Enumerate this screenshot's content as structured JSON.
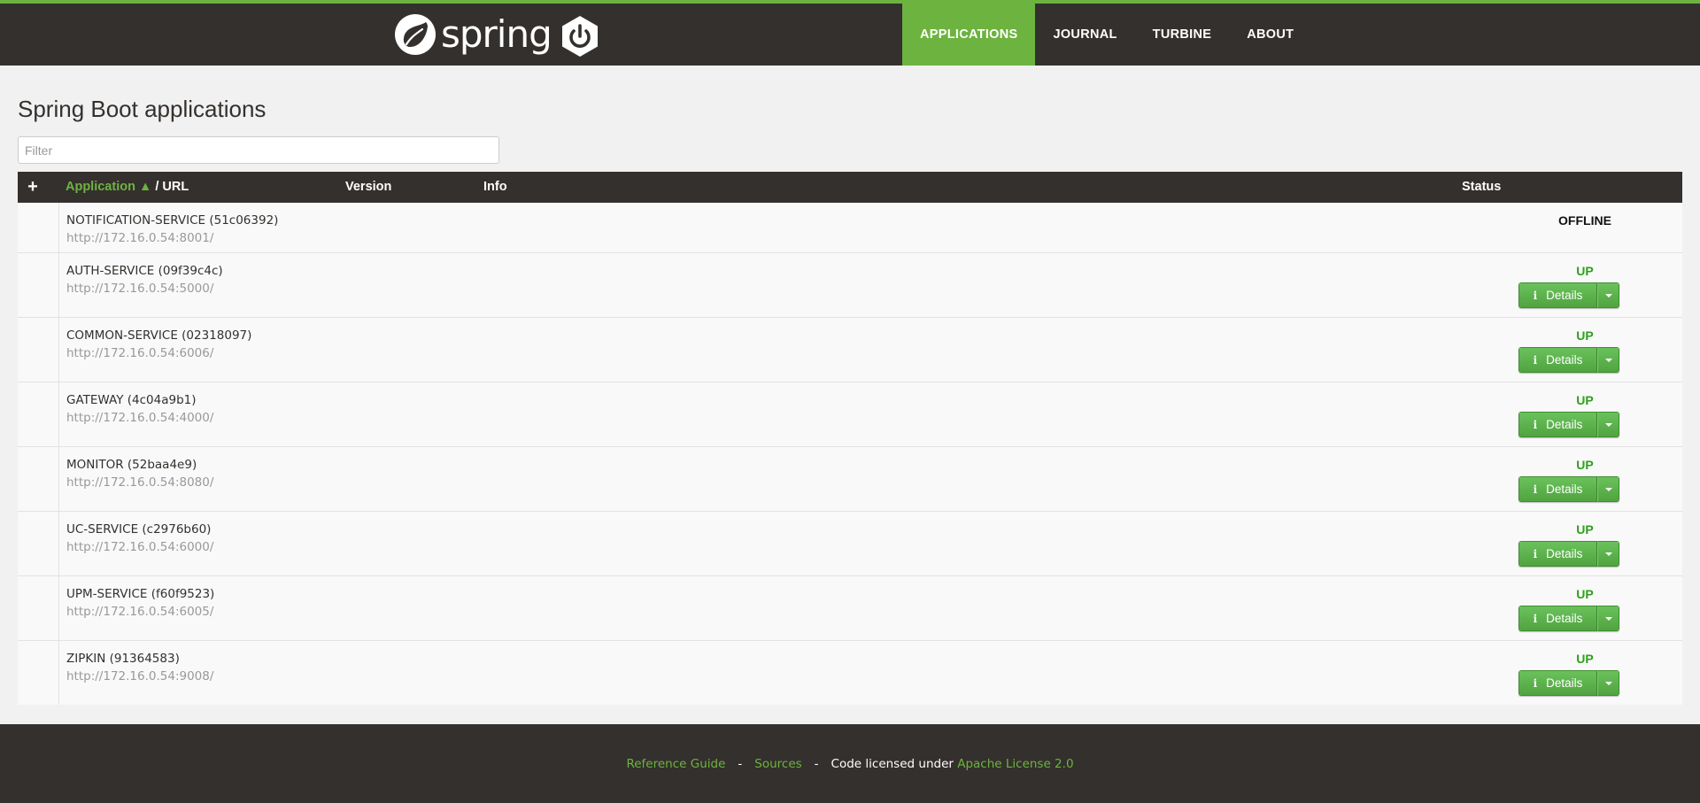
{
  "header": {
    "logo_text": "spring",
    "nav": [
      {
        "label": "APPLICATIONS",
        "active": true
      },
      {
        "label": "JOURNAL",
        "active": false
      },
      {
        "label": "TURBINE",
        "active": false
      },
      {
        "label": "ABOUT",
        "active": false
      }
    ]
  },
  "page": {
    "title": "Spring Boot applications",
    "filter_placeholder": "Filter"
  },
  "table": {
    "headers": {
      "expand": "+",
      "application": "Application",
      "sort_indicator": "▲",
      "url": " / URL",
      "version": "Version",
      "info": "Info",
      "status": "Status"
    },
    "details_label": "Details",
    "rows": [
      {
        "name": "NOTIFICATION-SERVICE (51c06392)",
        "url": "http://172.16.0.54:8001/",
        "status": "OFFLINE"
      },
      {
        "name": "AUTH-SERVICE (09f39c4c)",
        "url": "http://172.16.0.54:5000/",
        "status": "UP"
      },
      {
        "name": "COMMON-SERVICE (02318097)",
        "url": "http://172.16.0.54:6006/",
        "status": "UP"
      },
      {
        "name": "GATEWAY (4c04a9b1)",
        "url": "http://172.16.0.54:4000/",
        "status": "UP"
      },
      {
        "name": "MONITOR (52baa4e9)",
        "url": "http://172.16.0.54:8080/",
        "status": "UP"
      },
      {
        "name": "UC-SERVICE (c2976b60)",
        "url": "http://172.16.0.54:6000/",
        "status": "UP"
      },
      {
        "name": "UPM-SERVICE (f60f9523)",
        "url": "http://172.16.0.54:6005/",
        "status": "UP"
      },
      {
        "name": "ZIPKIN (91364583)",
        "url": "http://172.16.0.54:9008/",
        "status": "UP"
      }
    ]
  },
  "footer": {
    "reference_guide": "Reference Guide",
    "sep1": "-",
    "sources": "Sources",
    "sep2": "-",
    "licensed_text": "Code licensed under ",
    "license_link": "Apache License 2.0"
  },
  "colors": {
    "brand_green": "#6db33f",
    "header_dark": "#34302d",
    "status_up": "#2ea01d",
    "status_offline": "#111111"
  },
  "icons": {
    "logo": "spring-leaf-icon",
    "badge": "power-icon",
    "details": "info-icon",
    "dropdown": "caret-down-icon",
    "expand": "plus-icon"
  }
}
